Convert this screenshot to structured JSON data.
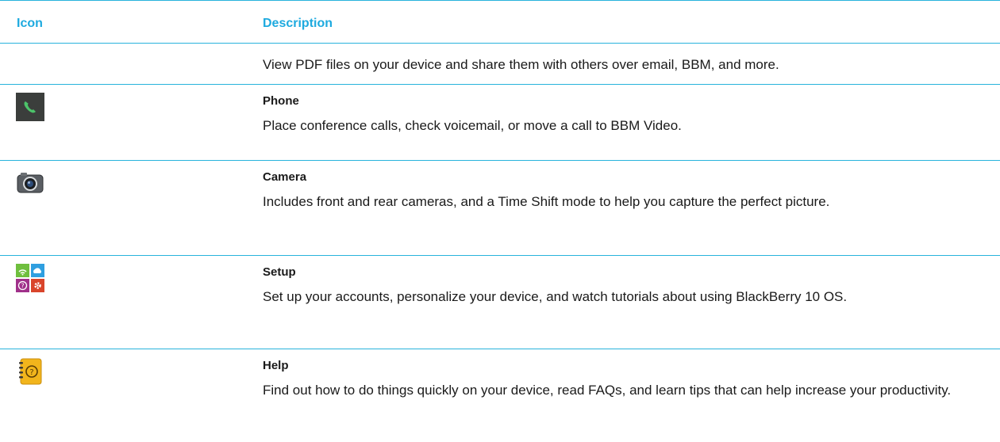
{
  "table": {
    "headers": {
      "icon": "Icon",
      "description": "Description"
    },
    "rows": [
      {
        "icon": "pdf-icon",
        "title": "",
        "description": "View PDF files on your device and share them with others over email, BBM, and more."
      },
      {
        "icon": "phone-icon",
        "title": "Phone",
        "description": "Place conference calls, check voicemail, or move a call to BBM Video."
      },
      {
        "icon": "camera-icon",
        "title": "Camera",
        "description": "Includes front and rear cameras, and a Time Shift mode to help you capture the perfect picture."
      },
      {
        "icon": "setup-icon",
        "title": "Setup",
        "description": "Set up your accounts, personalize your device, and watch tutorials about using BlackBerry 10 OS."
      },
      {
        "icon": "help-icon",
        "title": "Help",
        "description": "Find out how to do things quickly on your device, read FAQs, and learn tips that can help increase your productivity."
      }
    ]
  },
  "colors": {
    "accent": "#1eaadf",
    "rule": "#28b3dc"
  }
}
